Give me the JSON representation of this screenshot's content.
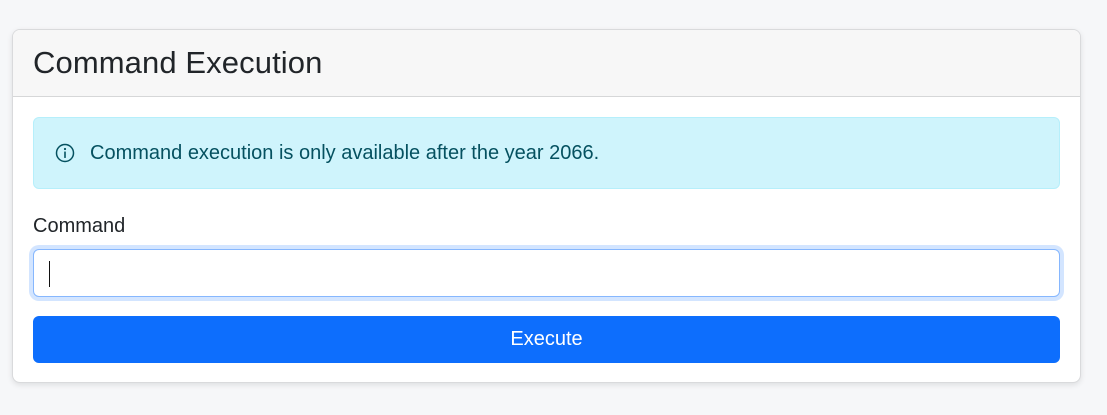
{
  "card": {
    "title": "Command Execution"
  },
  "alert": {
    "icon": "info-icon",
    "message": "Command execution is only available after the year 2066.",
    "color": "#055160",
    "background": "#cff4fc"
  },
  "form": {
    "command_label": "Command",
    "command_value": "",
    "command_placeholder": "",
    "execute_label": "Execute",
    "button_color": "#0d6efd"
  }
}
